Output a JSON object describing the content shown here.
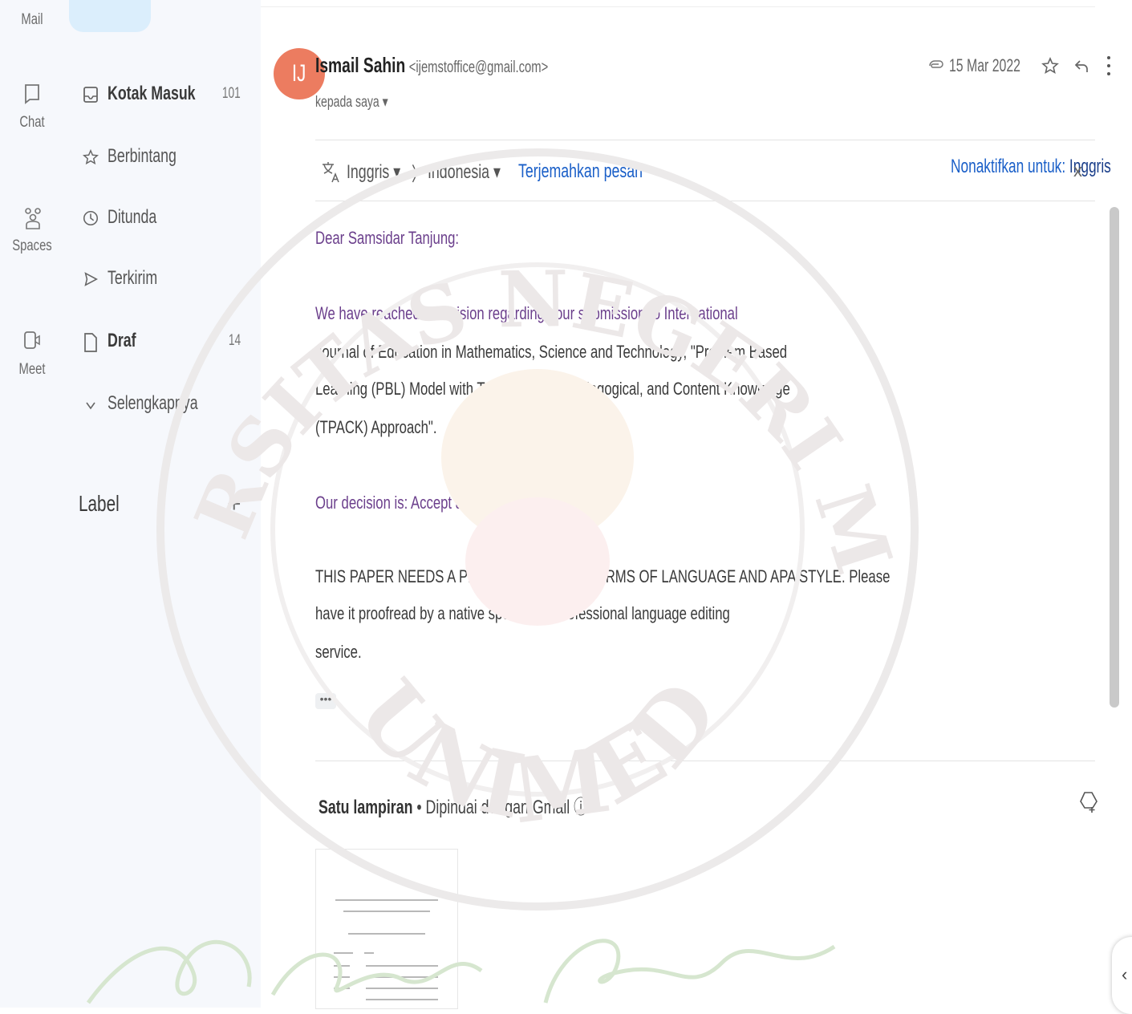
{
  "rail": {
    "mail_label": "Mail",
    "chat_label": "Chat",
    "spaces_label": "Spaces",
    "meet_label": "Meet"
  },
  "nav": {
    "items": [
      {
        "label": "Kotak Masuk",
        "count": "101",
        "icon": "inbox-icon",
        "bold": true
      },
      {
        "label": "Berbintang",
        "count": "",
        "icon": "star-icon",
        "bold": false
      },
      {
        "label": "Ditunda",
        "count": "",
        "icon": "clock-icon",
        "bold": false
      },
      {
        "label": "Terkirim",
        "count": "",
        "icon": "send-icon",
        "bold": false
      },
      {
        "label": "Draf",
        "count": "14",
        "icon": "draft-icon",
        "bold": true
      },
      {
        "label": "Selengkapnya",
        "count": "",
        "icon": "chevron-down-icon",
        "bold": false
      }
    ],
    "label_heading": "Label",
    "label_add": "+"
  },
  "message": {
    "avatar_initials": "IJ",
    "sender_name": "Ismail Sahin",
    "sender_email": "<ijemstoffice@gmail.com>",
    "recipient": "kepada saya ▾",
    "date": "15 Mar 2022",
    "translate": {
      "from": "Inggris ▾",
      "arrow": "〉",
      "to": "Indonesia ▾",
      "action": "Terjemahkan pesan",
      "disable_prefix": "Nonaktifkan untuk: ",
      "disable_lang": "Inggris",
      "close": "x"
    },
    "body": {
      "greeting": "Dear Samsidar Tanjung:",
      "p1_l1": "We have reached a decision regarding your submission to International",
      "p1_l2": "Journal of Education in Mathematics, Science and Technology, \"Problem Based",
      "p1_l3": "Learning (PBL) Model with Technological, Pedagogical, and Content Knowledge",
      "p1_l4": "(TPACK) Approach\".",
      "decision": "Our decision is:  Accept as an invited paper",
      "p3_l1": "THIS PAPER NEEDS A PROOFREADING IN TERMS OF LANGUAGE AND APA STYLE. Please",
      "p3_l2": "have it proofread by a native speaker or professional language editing",
      "p3_l3": "service.",
      "more": "•••"
    },
    "attachments": {
      "heading": "Satu lampiran",
      "separator": " • ",
      "scan_note": "Dipindai dengan Gmail",
      "info": "ⓘ"
    }
  },
  "side_toggle": "‹",
  "watermark": {
    "text_top": "UNIVERSITAS NEGERI MEDAN",
    "text_bottom": "UNIMED"
  },
  "colors": {
    "accent": "#1a5fc8",
    "avatar": "#ec7c60",
    "body_purple": "#6b3f8c",
    "sidebar_bg": "#f6f8fc"
  }
}
